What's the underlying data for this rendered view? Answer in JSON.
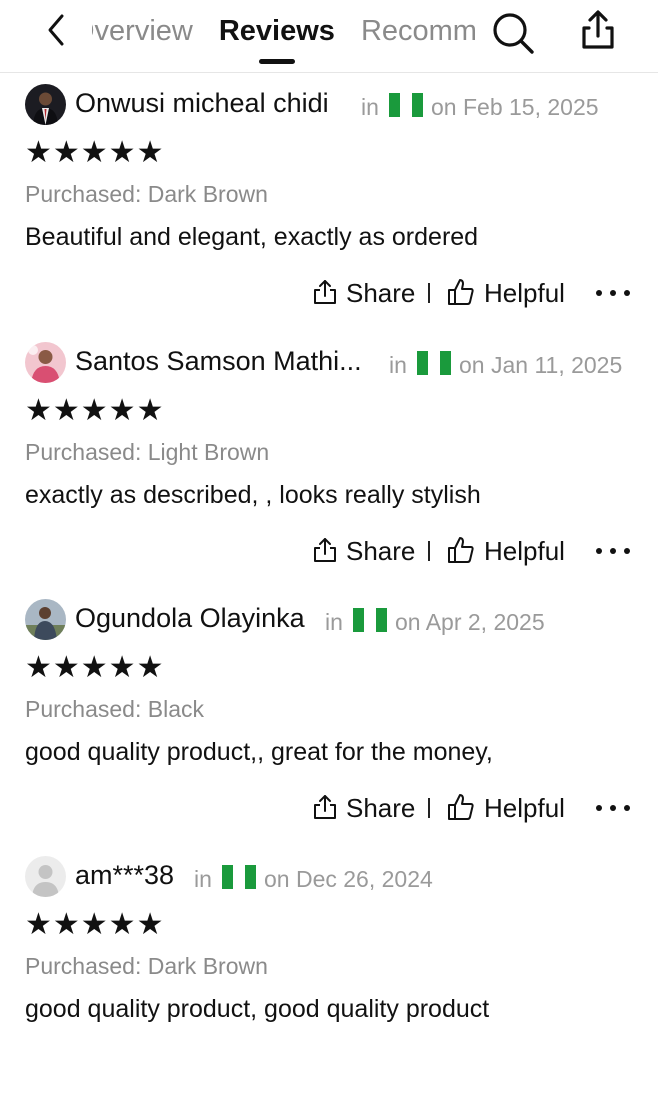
{
  "header": {
    "tabs": [
      {
        "label": "Overview",
        "active": false
      },
      {
        "label": "Reviews",
        "active": true
      },
      {
        "label": "Recommended",
        "active": false
      }
    ],
    "icons": {
      "back": "chevron-left-icon",
      "search": "search-icon",
      "share": "share-icon"
    }
  },
  "reviews": [
    {
      "name": "Onwusi micheal chidi",
      "in_label": "in",
      "country_flag": "nigeria-flag-icon",
      "date": "on Feb 15, 2025",
      "stars": "★★★★★",
      "rating": 5,
      "purchased": "Purchased: Dark Brown",
      "text": "Beautiful and elegant, exactly as ordered",
      "share_label": "Share",
      "helpful_label": "Helpful"
    },
    {
      "name": "Santos Samson Mathi...",
      "in_label": "in",
      "country_flag": "nigeria-flag-icon",
      "date": "on Jan 11, 2025",
      "stars": "★★★★★",
      "rating": 5,
      "purchased": "Purchased: Light Brown",
      "text": "exactly as described, , looks really stylish",
      "share_label": "Share",
      "helpful_label": "Helpful"
    },
    {
      "name": "Ogundola Olayinka",
      "in_label": "in",
      "country_flag": "nigeria-flag-icon",
      "date": "on Apr 2, 2025",
      "stars": "★★★★★",
      "rating": 5,
      "purchased": "Purchased: Black",
      "text": "good quality product,, great for the money,",
      "share_label": "Share",
      "helpful_label": "Helpful"
    },
    {
      "name": "am***38",
      "in_label": "in",
      "country_flag": "nigeria-flag-icon",
      "date": "on Dec 26, 2024",
      "stars": "★★★★★",
      "rating": 5,
      "purchased": "Purchased: Dark Brown",
      "text": "good quality product, good quality product",
      "share_label": "Share",
      "helpful_label": "Helpful"
    }
  ],
  "colors": {
    "flag_green": "#1a9a3c",
    "muted_text": "#8a8a8a"
  }
}
